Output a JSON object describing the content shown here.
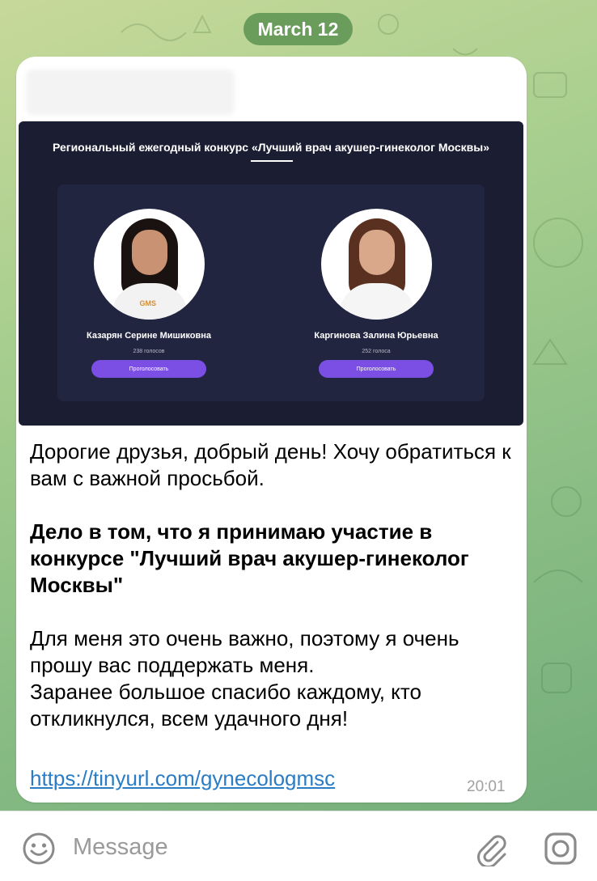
{
  "date_label": "March 12",
  "post": {
    "image": {
      "title": "Региональный ежегодный конкурс «Лучший врач акушер-гинеколог Москвы»",
      "candidates": [
        {
          "name": "Казарян Серине Мишиковна",
          "votes": "238 голосов",
          "button": "Проголосовать",
          "badge": "GMS"
        },
        {
          "name": "Каргинова Залина Юрьевна",
          "votes": "252 голоса",
          "button": "Проголосовать"
        }
      ]
    },
    "text": {
      "p1": "Дорогие друзья, добрый день! Хочу обратиться к вам с важной просьбой.",
      "p2": "Дело в том, что я принимаю участие в конкурсе \"Лучший врач акушер-гинеколог Москвы\"",
      "p3": "Для меня это очень важно, поэтому я очень прошу вас поддержать меня.",
      "p4": "Заранее большое спасибо каждому, кто откликнулся, всем удачного дня!"
    },
    "link": "https://tinyurl.com/gynecologmsc",
    "time": "20:01"
  },
  "input": {
    "placeholder": "Message",
    "icons": {
      "emoji": "smile-icon",
      "attach": "paperclip-icon",
      "camera": "camera-icon"
    }
  },
  "colors": {
    "date_pill": "#6a9d5c",
    "link": "#2a7cc4",
    "vote_button": "#7b4ee4",
    "media_bg": "#1b1d32"
  }
}
